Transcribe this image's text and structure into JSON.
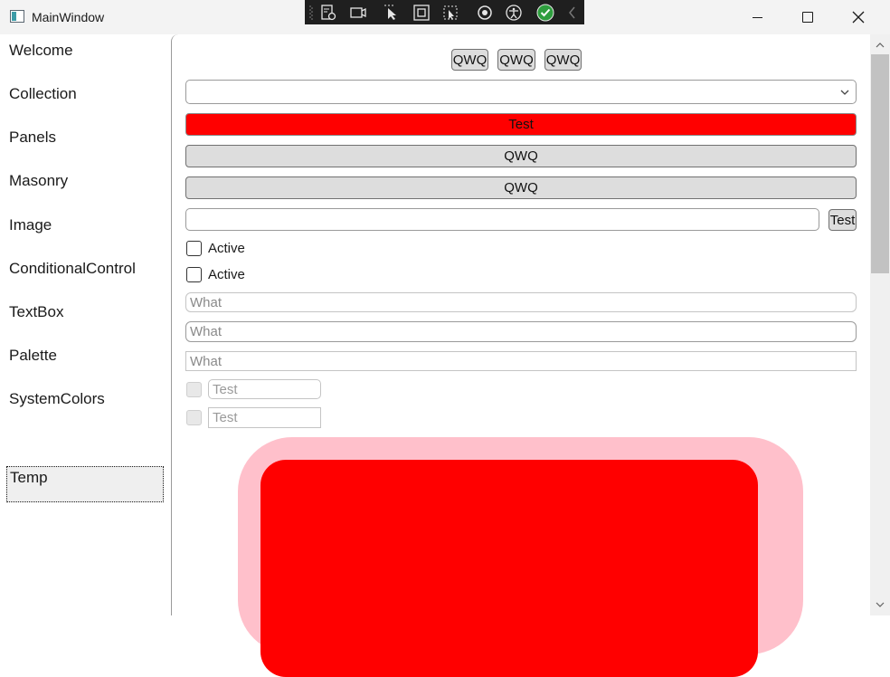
{
  "window": {
    "title": "MainWindow"
  },
  "toolbar": {
    "icons": [
      "live-visual-tree-icon",
      "record-icon",
      "select-element-icon",
      "display-layout-adorners-icon",
      "track-focus-icon",
      "binding-failures-icon",
      "accessibility-icon",
      "hot-reload-ok-icon",
      "collapse-toolbar-icon"
    ]
  },
  "sidebar": {
    "items": [
      {
        "label": "Welcome"
      },
      {
        "label": "Collection"
      },
      {
        "label": "Panels"
      },
      {
        "label": "Masonry"
      },
      {
        "label": "Image"
      },
      {
        "label": "ConditionalControl"
      },
      {
        "label": "TextBox"
      },
      {
        "label": "Palette"
      },
      {
        "label": "SystemColors"
      },
      {
        "label": "Temp"
      }
    ],
    "selected": "Temp"
  },
  "content": {
    "top_buttons": [
      "QWQ",
      "QWQ",
      "QWQ"
    ],
    "combo_value": "",
    "red_button_label": "Test",
    "wide_buttons": [
      "QWQ",
      "QWQ"
    ],
    "text_input_value": "",
    "side_button_label": "Test",
    "checkboxes": [
      {
        "label": "Active",
        "checked": false
      },
      {
        "label": "Active",
        "checked": false
      }
    ],
    "what_fields": [
      "What",
      "What",
      "What"
    ],
    "small_fields": [
      {
        "value": "Test",
        "enabled": false
      },
      {
        "value": "Test",
        "enabled": false
      }
    ]
  },
  "colors": {
    "red_accent": "#ff0000",
    "pink_frame": "#ffc0cb",
    "button_gray": "#dddddd"
  }
}
